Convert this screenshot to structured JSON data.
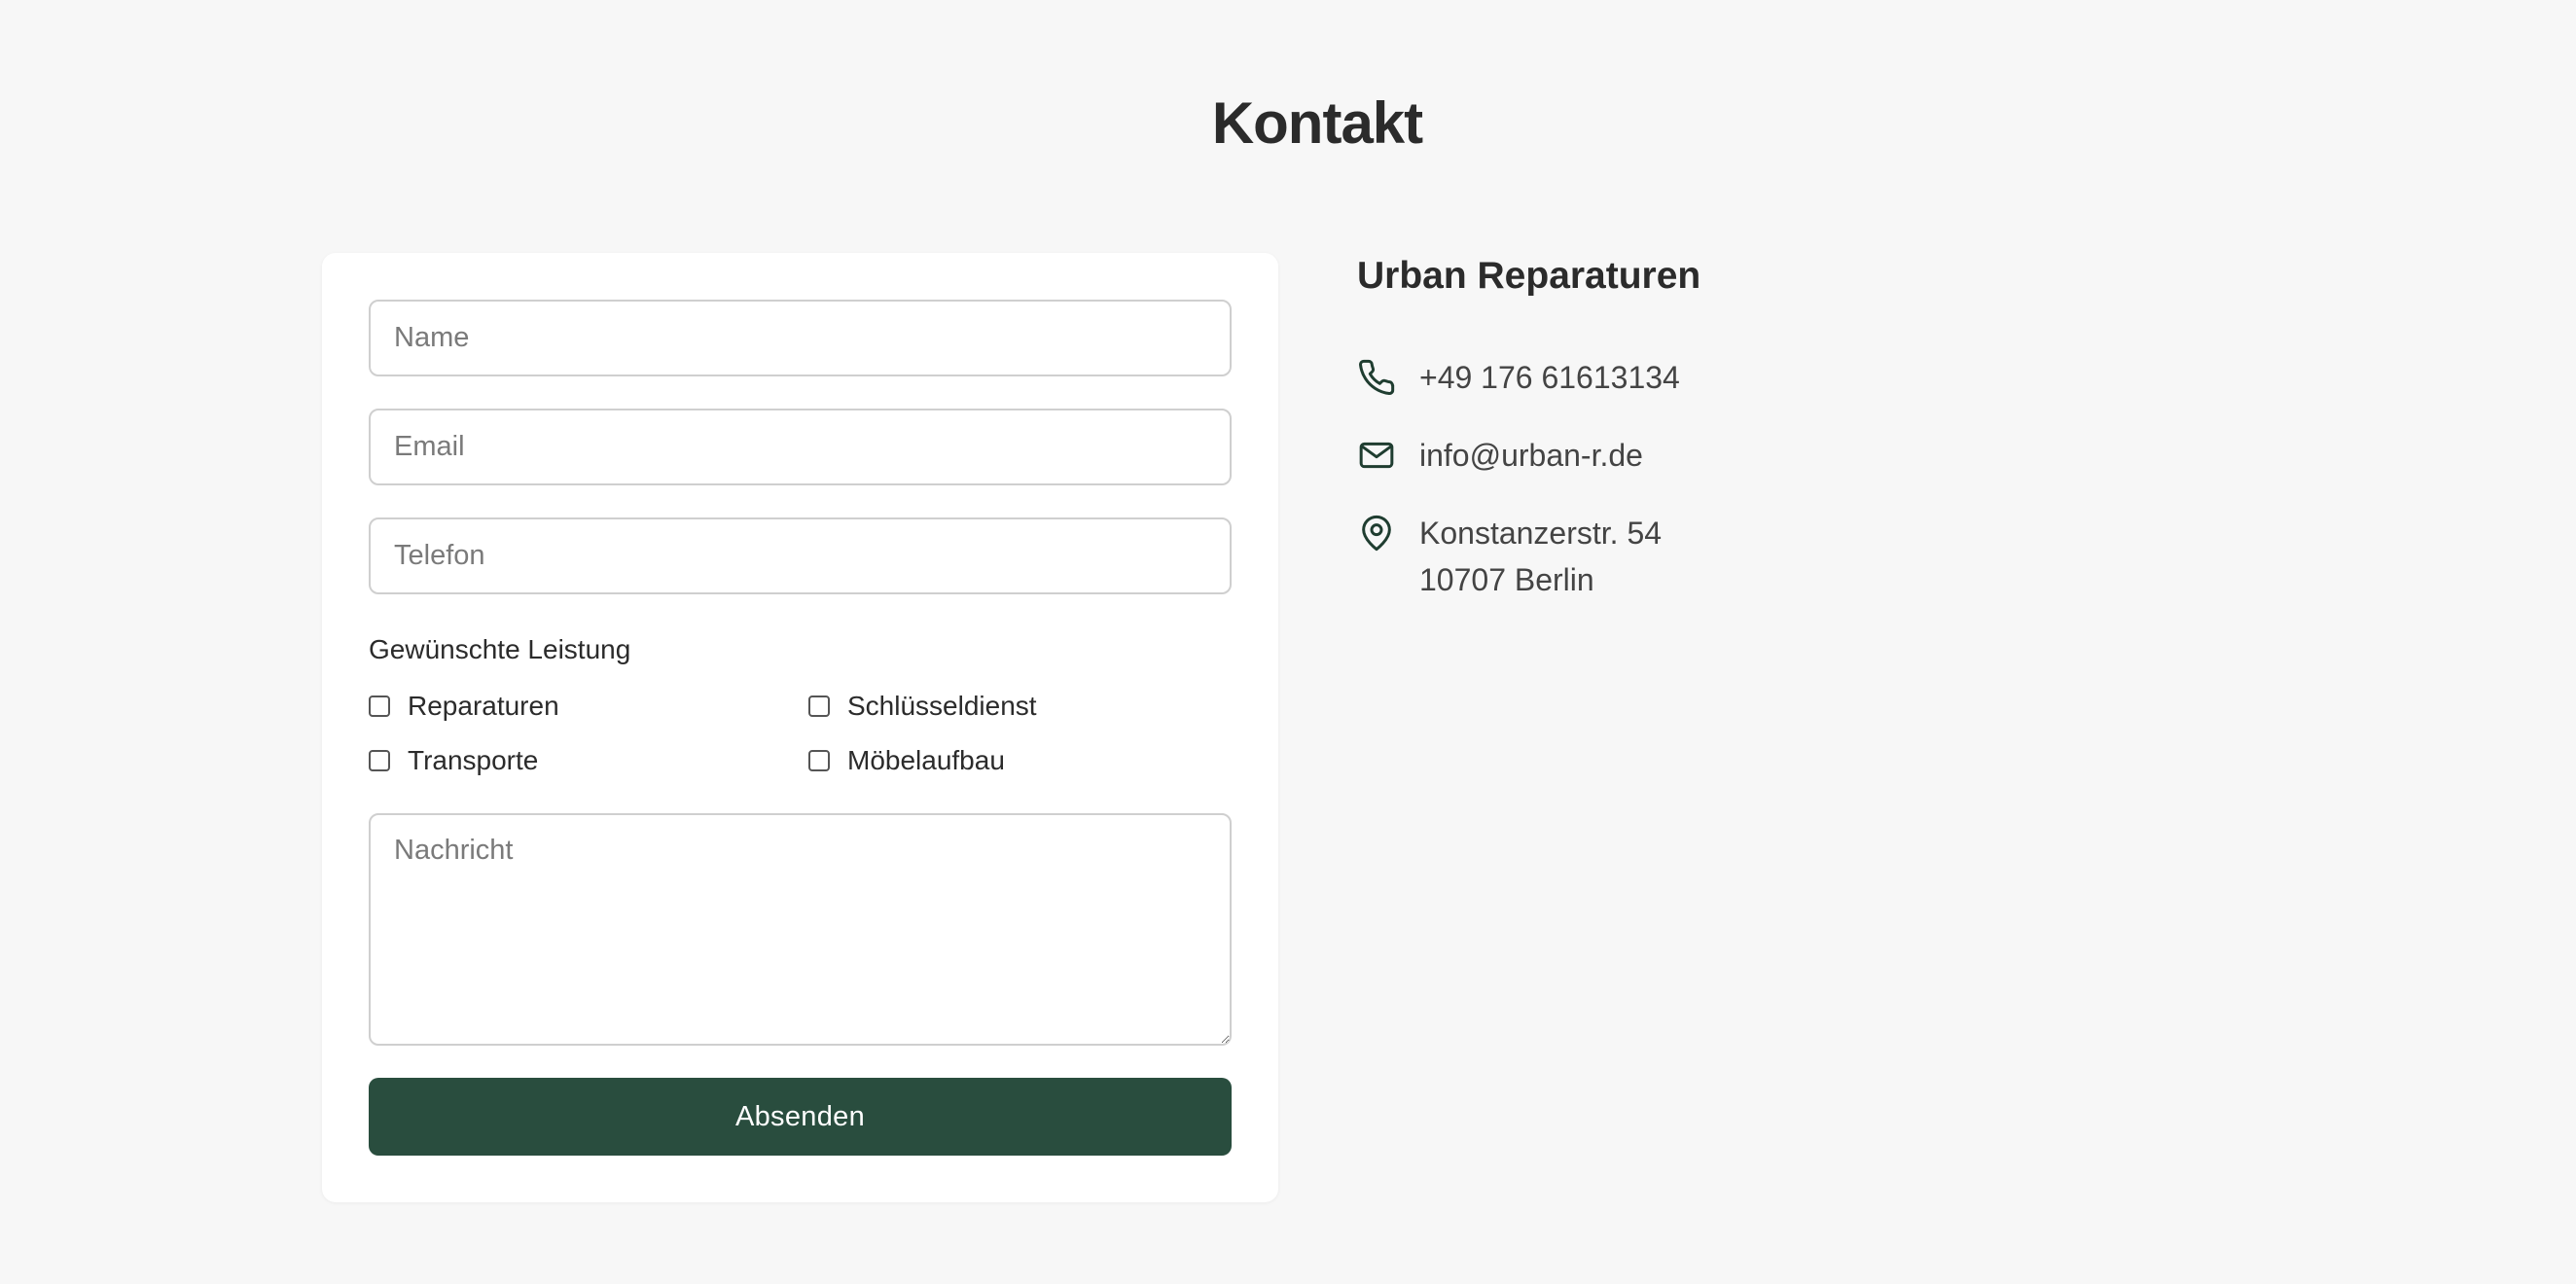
{
  "page": {
    "title": "Kontakt"
  },
  "form": {
    "name_placeholder": "Name",
    "email_placeholder": "Email",
    "phone_placeholder": "Telefon",
    "services_label": "Gewünschte Leistung",
    "services": [
      {
        "label": "Reparaturen",
        "checked": false
      },
      {
        "label": "Schlüsseldienst",
        "checked": false
      },
      {
        "label": "Transporte",
        "checked": false
      },
      {
        "label": "Möbelaufbau",
        "checked": false
      }
    ],
    "message_placeholder": "Nachricht",
    "submit_label": "Absenden"
  },
  "contact": {
    "company": "Urban Reparaturen",
    "phone": "+49 176 61613134",
    "email": "info@urban-r.de",
    "address_line1": "Konstanzerstr. 54",
    "address_line2": "10707 Berlin"
  },
  "icons": {
    "phone": "phone-icon",
    "email": "mail-icon",
    "address": "map-pin-icon"
  },
  "colors": {
    "background": "#f7f7f7",
    "card": "#ffffff",
    "accent": "#294d3e",
    "icon": "#1f3d30"
  }
}
